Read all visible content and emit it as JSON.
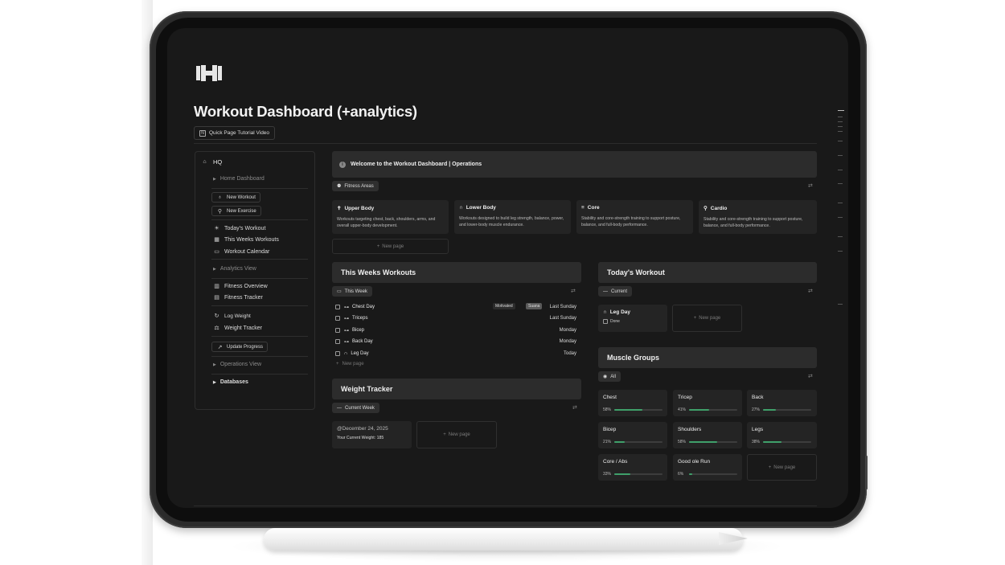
{
  "page": {
    "title": "Workout Dashboard (+analytics)",
    "tutorial_button": "Quick Page Tutorial Video"
  },
  "sidebar": {
    "hq": "HQ",
    "home_dashboard": "Home Dashboard",
    "new_workout": "New Workout",
    "new_exercise": "New Exercise",
    "todays_workout": "Today's Workout",
    "this_weeks_workouts": "This Weeks Workouts",
    "workout_calendar": "Workout Calendar",
    "analytics_view": "Analytics View",
    "fitness_overview": "Fitness Overview",
    "fitness_tracker": "Fitness Tracker",
    "log_weight": "Log Weight",
    "weight_tracker": "Weight Tracker",
    "update_progress": "Update Progress",
    "operations_view": "Operations View",
    "databases": "Databases"
  },
  "welcome": "Welcome to the Workout Dashboard | Operations",
  "fitness_areas": {
    "chip": "Fitness Areas",
    "new_page": "New page",
    "cards": [
      {
        "title": "Upper Body",
        "desc": "Workouts targeting chest, back, shoulders, arms, and overall upper-body development."
      },
      {
        "title": "Lower Body",
        "desc": "Workouts designed to build leg strength, balance, power, and lower-body muscle endurance."
      },
      {
        "title": "Core",
        "desc": "Stability and core-strength training to support posture, balance, and full-body performance."
      },
      {
        "title": "Cardio",
        "desc": "Stability and core-strength training to support posture, balance, and full-body performance."
      }
    ]
  },
  "this_weeks_workouts": {
    "header": "This Weeks Workouts",
    "view": "This Week",
    "new_page": "New page",
    "rows": [
      {
        "name": "Chest Day",
        "tag1": "Motivated",
        "tag2": "Suana",
        "date": "Last Sunday"
      },
      {
        "name": "Triceps",
        "date": "Last Sunday"
      },
      {
        "name": "Bicep",
        "date": "Monday"
      },
      {
        "name": "Back Day",
        "date": "Monday"
      },
      {
        "name": "Leg Day",
        "date": "Today"
      }
    ]
  },
  "weight_tracker": {
    "header": "Weight Tracker",
    "view": "Current Week",
    "entry_date": "@December 24, 2025",
    "entry_weight": "Your Current Weight: 185",
    "new_page": "New page"
  },
  "todays_workout": {
    "header": "Today's Workout",
    "view": "Current",
    "card_title": "Leg Day",
    "card_check": "Done",
    "new_page": "New page"
  },
  "muscle_groups": {
    "header": "Muscle Groups",
    "view": "All",
    "new_page": "New page",
    "items": [
      {
        "name": "Chest",
        "pct_label": "58%",
        "pct": 58
      },
      {
        "name": "Tricep",
        "pct_label": "41%",
        "pct": 41
      },
      {
        "name": "Back",
        "pct_label": "27%",
        "pct": 27
      },
      {
        "name": "Bicep",
        "pct_label": "21%",
        "pct": 21
      },
      {
        "name": "Shoulders",
        "pct_label": "58%",
        "pct": 58
      },
      {
        "name": "Legs",
        "pct_label": "38%",
        "pct": 38
      },
      {
        "name": "Core / Abs",
        "pct_label": "33%",
        "pct": 33
      },
      {
        "name": "Good ole Run",
        "pct_label": "6%",
        "pct": 6
      }
    ]
  },
  "colors": {
    "background": "#191919",
    "card": "#242424",
    "header": "#2c2c2c",
    "progress": "#3fa06a"
  }
}
